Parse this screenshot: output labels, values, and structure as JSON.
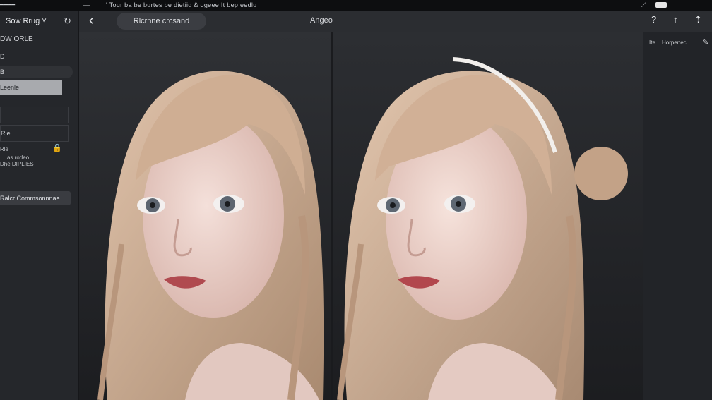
{
  "top_bar": {
    "caption": "' Tour ba be burtes be dietiid & ogeee It bep eedlu",
    "dash": "—",
    "right_indicator": "⟋",
    "tiny_label": "━━━━━"
  },
  "sidebar": {
    "title": "Sow Rrug",
    "title_suffix": "˅",
    "refresh_icon": "↻",
    "section_label": "DW ORLE",
    "item_1": "D",
    "item_2": "B",
    "selected_item": "Leenle",
    "box_1": "",
    "box_2": "Rle",
    "field_label": "Rle",
    "caption_line_1": "as rodeo",
    "caption_line_2": "Dhe DIPLIES",
    "lock_icon": "🔒",
    "action_button": "Ralcr Commsonnnae"
  },
  "toolbar": {
    "back_icon": "‹",
    "mode_button": "Rlcrnne crcsand",
    "center_title": "Angeo",
    "icon_help": "?",
    "icon_up": "↑",
    "icon_upload": "⇡"
  },
  "right_panel": {
    "label": "Ite",
    "value": "Horpenec",
    "edit_icon": "✎"
  },
  "colors": {
    "background": "#1d1f23",
    "panel": "#2a2c30",
    "hair": "#c9a98e",
    "skin": "#e8cfc7"
  }
}
